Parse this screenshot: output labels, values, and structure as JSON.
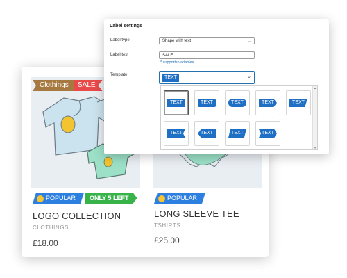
{
  "products": [
    {
      "tags": [
        "Clothings",
        "SALE"
      ],
      "popular": "POPULAR",
      "stock": "ONLY 5 LEFT",
      "title": "LOGO COLLECTION",
      "category": "CLOTHINGS",
      "price": "£18.00"
    },
    {
      "popular": "POPULAR",
      "title": "LONG SLEEVE TEE",
      "category": "TSHIRTS",
      "price": "£25.00"
    }
  ],
  "settings": {
    "title": "Label settings",
    "label_type_label": "Label type",
    "label_type_value": "Shape with text",
    "label_text_label": "Label text",
    "label_text_value": "SALE",
    "hint": "* supports variables",
    "template_label": "Template",
    "template_value": "TEXT",
    "templates": [
      "TEXT",
      "TEXT",
      "TEXT",
      "TEXT",
      "TEXT",
      "TEXT",
      "TEXT",
      "TEXT",
      "TEXT"
    ]
  },
  "colors": {
    "accent_blue": "#1f6fc4",
    "sale_red": "#e84a4a",
    "category_brown": "#a5793f",
    "stock_green": "#37b34a"
  }
}
